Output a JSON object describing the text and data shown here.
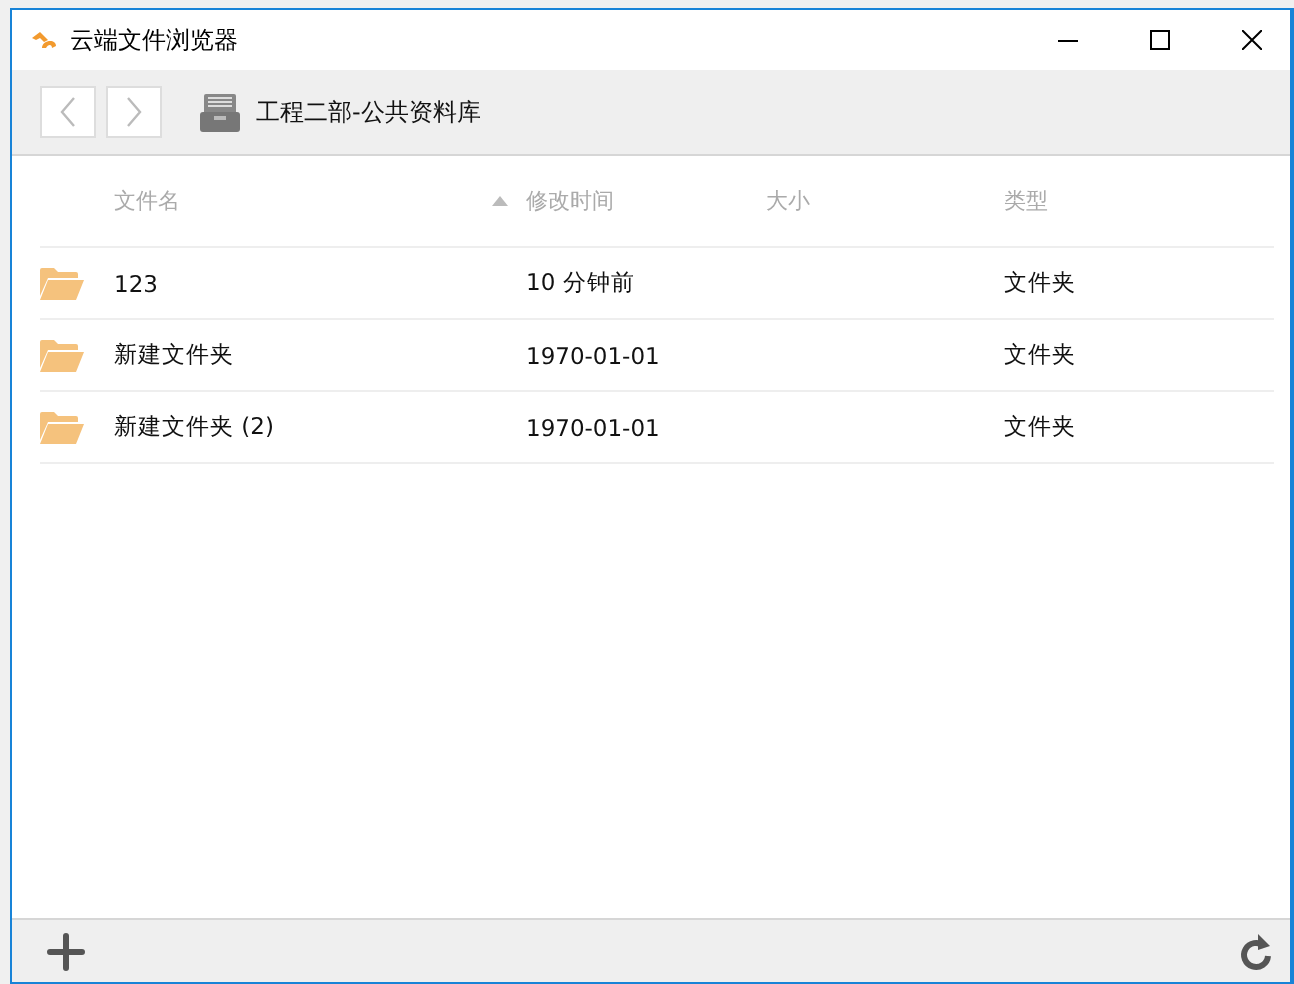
{
  "window": {
    "title": "云端文件浏览器"
  },
  "toolbar": {
    "path": "工程二部-公共资料库"
  },
  "table": {
    "columns": [
      {
        "label": "文件名"
      },
      {
        "label": "修改时间"
      },
      {
        "label": "大小"
      },
      {
        "label": "类型"
      }
    ],
    "rows": [
      {
        "name": "123",
        "modified": "10 分钟前",
        "type": "文件夹"
      },
      {
        "name": "新建文件夹",
        "modified": "1970-01-01",
        "type": "文件夹"
      },
      {
        "name": "新建文件夹 (2)",
        "modified": "1970-01-01",
        "type": "文件夹"
      }
    ]
  }
}
